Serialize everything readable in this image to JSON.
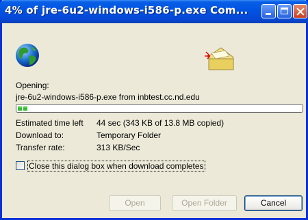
{
  "window": {
    "title": "4% of jre-6u2-windows-i586-p.exe Com...",
    "title_colors": {
      "bar": "#0054e3",
      "text": "#ffffff"
    }
  },
  "icons": {
    "globe": "globe-icon",
    "folder": "folder-icon",
    "minimize": "minimize-icon",
    "maximize": "maximize-icon",
    "close": "close-icon"
  },
  "opening": {
    "label": "Opening:",
    "detail": "jre-6u2-windows-i586-p.exe from inbtest.cc.nd.edu"
  },
  "progress": {
    "percent": 4
  },
  "details": {
    "time_left_label": "Estimated time left",
    "time_left_value": "44 sec (343 KB of 13.8 MB copied)",
    "download_to_label": "Download to:",
    "download_to_value": "Temporary Folder",
    "rate_label": "Transfer rate:",
    "rate_value": "313 KB/Sec"
  },
  "options": {
    "close_when_done_label": "Close this dialog box when download completes",
    "close_when_done_checked": false
  },
  "buttons": {
    "open": "Open",
    "open_folder": "Open Folder",
    "cancel": "Cancel"
  }
}
